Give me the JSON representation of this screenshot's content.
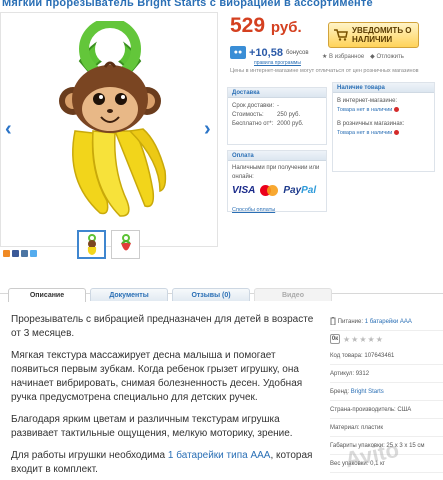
{
  "product": {
    "title": "Мягкий прорезыватель Bright Starts с вибрацией в ассортименте"
  },
  "gallery": {
    "prev_arrow": "‹",
    "next_arrow": "›",
    "thumbs": [
      "monkey-teether",
      "strawberry-teether"
    ]
  },
  "price": {
    "value": "529",
    "currency": "руб.",
    "cart_button": "Уведомить о наличии",
    "bonus_value": "+10,58",
    "bonus_label": "бонусов",
    "bonus_rules": "правила программы",
    "favorite": "В избранное",
    "track": "Отложить",
    "note": "Цены в интернет-магазине могут отличаться от цен розничных магазинов"
  },
  "delivery": {
    "heading": "Доставка",
    "rows": [
      {
        "label": "Срок доставки:",
        "value": "-"
      },
      {
        "label": "Стоимость:",
        "value": "250 руб."
      },
      {
        "label": "Бесплатно от*:",
        "value": "2000 руб."
      }
    ]
  },
  "availability": {
    "heading": "Наличие товара",
    "online_label": "В интернет-магазине:",
    "online_status": "Товара нет в наличии",
    "retail_label": "В розничных магазинах:",
    "retail_status": "Товара нет в наличии"
  },
  "payment": {
    "heading": "Оплата",
    "subtitle": "Наличными при получении или онлайн:",
    "visa": "VISA",
    "paypal_a": "Pay",
    "paypal_b": "Pal",
    "link": "Способы оплаты"
  },
  "tabs": [
    {
      "label": "Описание"
    },
    {
      "label": "Документы"
    },
    {
      "label": "Отзывы (0)"
    },
    {
      "label": "Видео"
    }
  ],
  "description": {
    "p1": "Прорезыватель с вибрацией предназначен для детей в возрасте от 3 месяцев.",
    "p2": "Мягкая текстура массажирует десна малыша и помогает появиться первым зубкам. Когда ребенок грызет игрушку, она начинает вибрировать, снимая болезненность десен. Удобная ручка предусмотрена специально для детских ручек.",
    "p3": "Благодаря ярким цветам и различным текстурам игрушка развивает тактильные ощущения, мелкую моторику, зрение.",
    "p4_pre": "Для работы игрушки необходима ",
    "p4_link": "1 батарейки типа AAA",
    "p4_post": ", которая входит в комплект."
  },
  "specs": {
    "power_label": "Питание:",
    "power_value": "1 батарейки AAA",
    "rating_box": "0к",
    "stars": "★★★★★",
    "code": "Код товара: 107643461",
    "article": "Артикул: 9312",
    "brand_label": "Бренд:",
    "brand_value": "Bright Starts",
    "country": "Страна-производитель: США",
    "material": "Материал: пластик",
    "size": "Габариты упаковки: 25 x 3 x 15 см",
    "weight": "Вес упаковки: 0,1 кг"
  },
  "watermark": "Avito",
  "colors": {
    "link": "#2a6fb5",
    "price": "#d44020",
    "stock_dot": "#d42b2b",
    "cart_button": "#ffd35a"
  }
}
